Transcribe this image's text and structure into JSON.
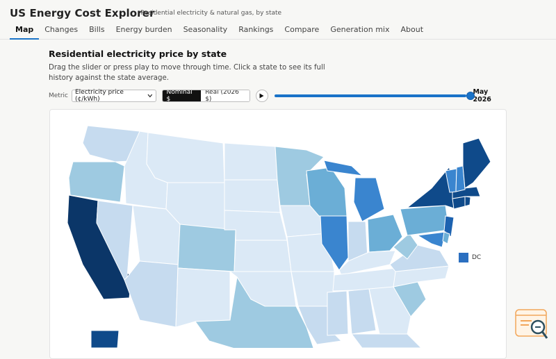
{
  "app": {
    "title": "US Energy Cost Explorer",
    "subtitle": "Residential electricity & natural gas, by state"
  },
  "tabs": [
    {
      "label": "Map",
      "active": true
    },
    {
      "label": "Changes",
      "active": false
    },
    {
      "label": "Bills",
      "active": false
    },
    {
      "label": "Energy burden",
      "active": false
    },
    {
      "label": "Seasonality",
      "active": false
    },
    {
      "label": "Rankings",
      "active": false
    },
    {
      "label": "Compare",
      "active": false
    },
    {
      "label": "Generation mix",
      "active": false
    },
    {
      "label": "About",
      "active": false
    }
  ],
  "panel": {
    "title": "Residential electricity price by state",
    "help": "Drag the slider or press play to move through time. Click a state to see its full history against the state average."
  },
  "controls": {
    "metric_label": "Metric",
    "metric_value": "Electricity price (¢/kWh)",
    "price_modes": [
      {
        "label": "Nominal $",
        "selected": true
      },
      {
        "label": "Real (2026 $)",
        "selected": false
      }
    ],
    "slider_position": 1.0,
    "date_value": "May 2026"
  },
  "map": {
    "dc_label": "DC",
    "colors": {
      "c1": "#dbe9f6",
      "c2": "#c6dbef",
      "c3": "#9ecae1",
      "c4": "#6baed6",
      "c5": "#3a85cf",
      "c6": "#1c62b0",
      "c7": "#0f4a8a",
      "c8": "#0b3668",
      "dc": "#2b6fc0",
      "border": "#ffffff"
    }
  },
  "icons": {
    "play": "play-icon",
    "chevron": "chevron-down-icon",
    "logo": "magnifier-logo-icon"
  }
}
